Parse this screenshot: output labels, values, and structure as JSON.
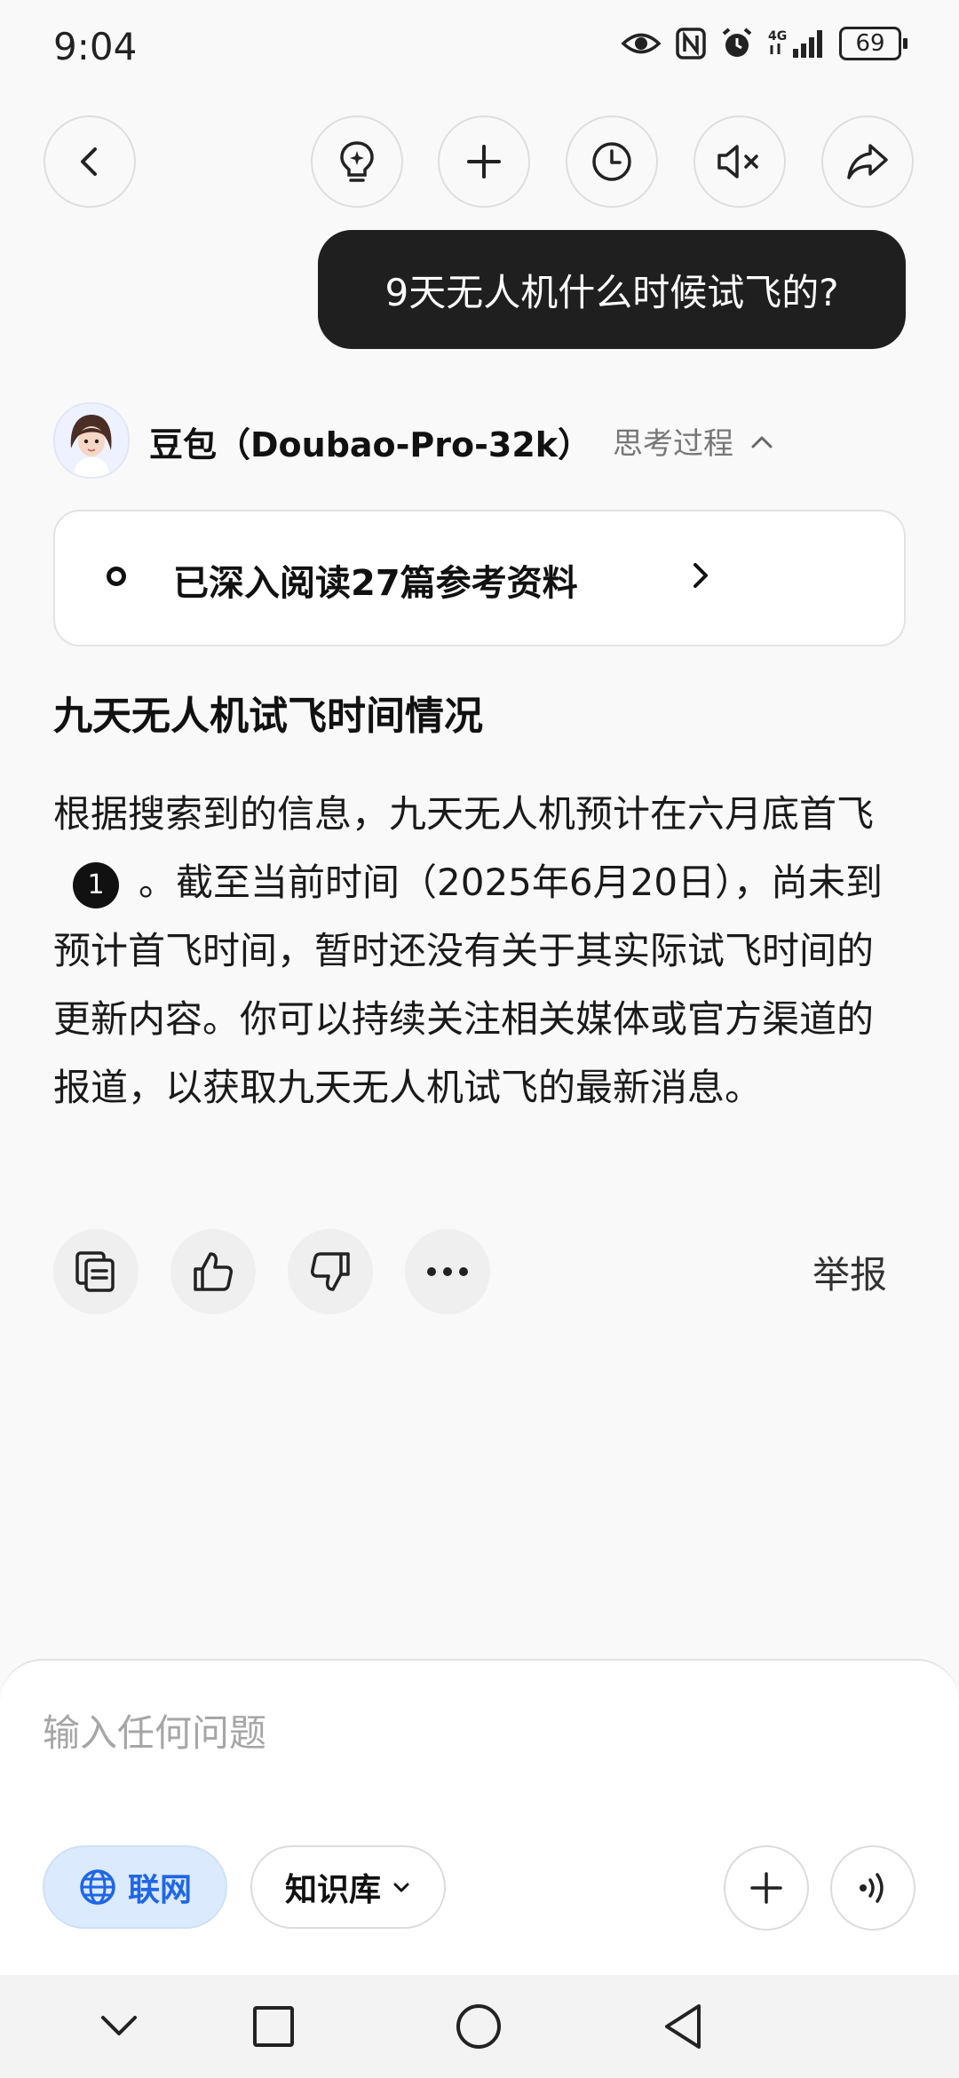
{
  "status_bar": {
    "time": "9:04",
    "battery": "69"
  },
  "top_bar": {
    "icons": [
      "back-icon",
      "lightbulb-icon",
      "plus-icon",
      "history-icon",
      "mute-icon",
      "share-icon"
    ]
  },
  "chat": {
    "user_message": "9天无人机什么时候试飞的?",
    "bot_name": "豆包（Doubao-Pro-32k）",
    "thinking_label": "思考过程",
    "reference_card": "已深入阅读27篇参考资料",
    "answer_title": "九天无人机试飞时间情况",
    "answer_part1": "根据搜索到的信息，九天无人机预计在六月底首飞",
    "citation": "1",
    "answer_part2": "。截至当前时间（2025年6月20日），尚未到预计首飞时间，暂时还没有关于其实际试飞时间的更新内容。你可以持续关注相关媒体或官方渠道的报道，以获取九天无人机试飞的最新消息。",
    "report_label": "举报"
  },
  "input": {
    "placeholder": "输入任何问题",
    "web_label": "联网",
    "kb_label": "知识库"
  },
  "colors": {
    "accent": "#1f66e6",
    "bubble": "#1f1f1f",
    "background": "#f9f9f9"
  }
}
